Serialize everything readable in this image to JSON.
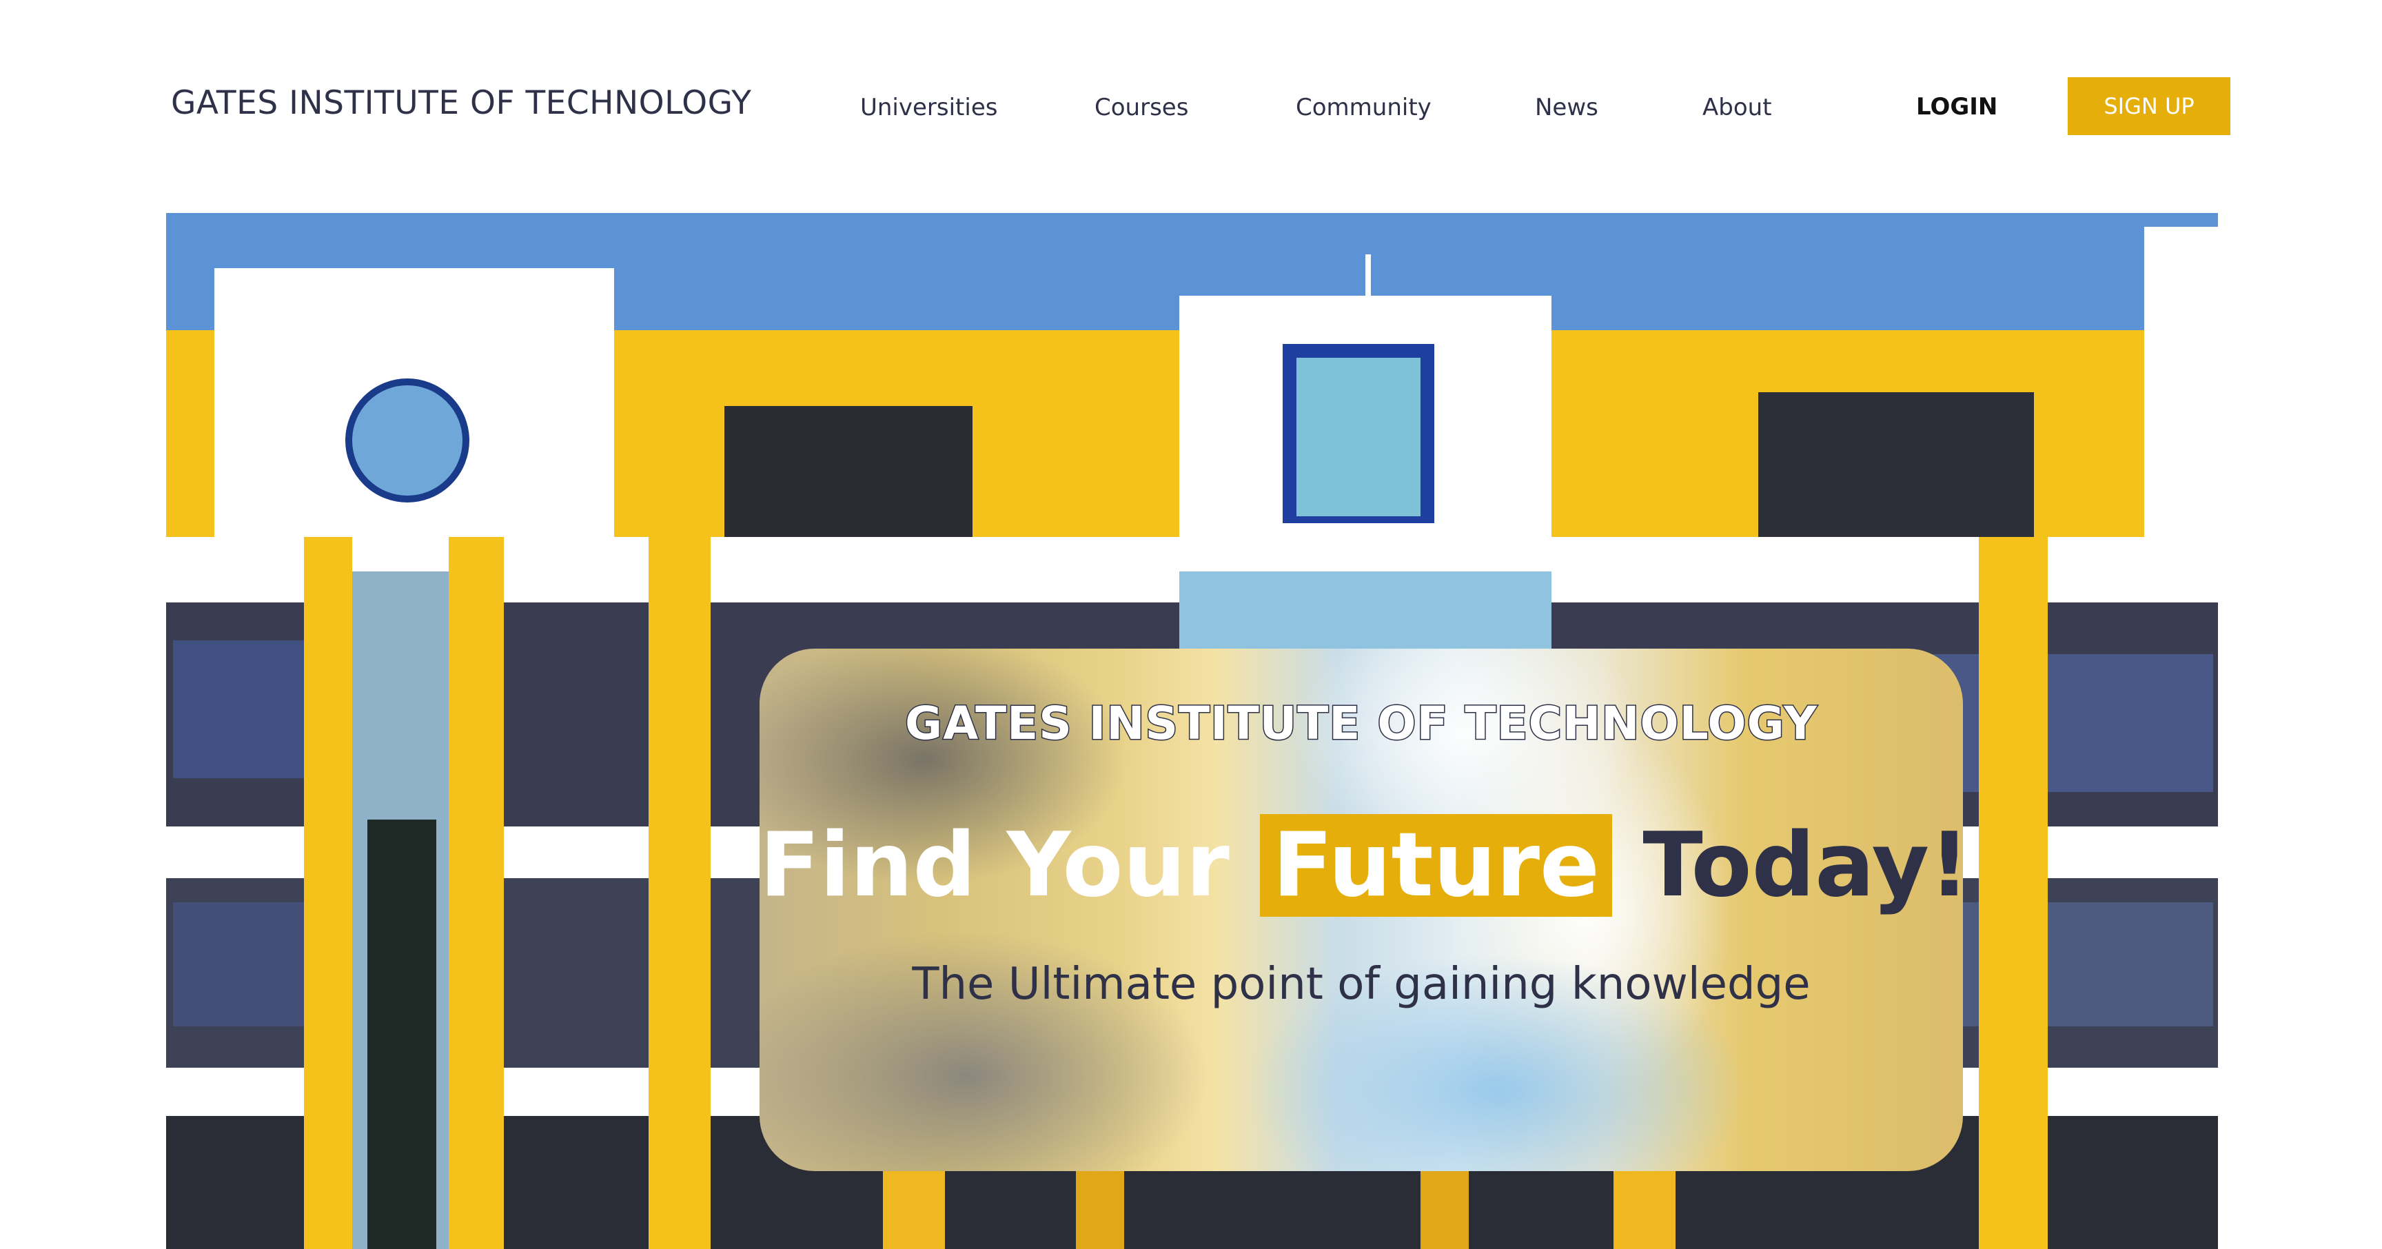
{
  "brand": {
    "name": "GATES INSTITUTE OF TECHNOLOGY"
  },
  "nav": {
    "links": [
      {
        "label": "Universities"
      },
      {
        "label": "Courses"
      },
      {
        "label": "Community"
      },
      {
        "label": "News"
      },
      {
        "label": "About"
      }
    ],
    "login_label": "LOGIN",
    "signup_label": "SIGN UP"
  },
  "hero": {
    "overlay_title": "GATES INSTITUTE OF TECHNOLOGY",
    "headline_part1": "Find Your ",
    "headline_highlight": "Future",
    "headline_part2": " Today!",
    "tagline": "The Ultimate point of gaining knowledge"
  },
  "colors": {
    "accent": "#e5ae0a",
    "text_dark": "#2e3147",
    "sky": "#5b93d6",
    "building_yellow": "#f5c21b"
  }
}
